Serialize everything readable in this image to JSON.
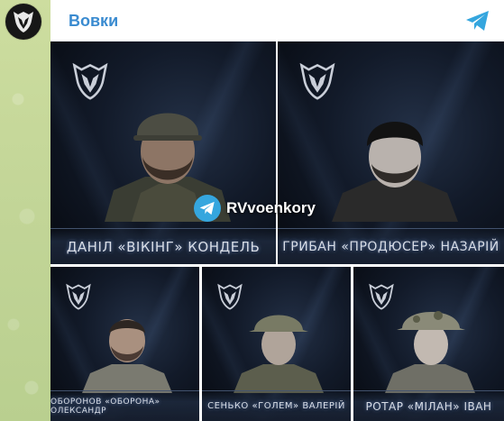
{
  "channel": {
    "name": "Вовки",
    "avatar_icon": "wolf-emblem-icon",
    "share_icon": "telegram-icon"
  },
  "watermark": {
    "text": "RVvoenkory",
    "icon": "telegram-icon"
  },
  "photos": [
    {
      "name_label": "ДАНІЛ «ВІКІНГ» КОНДЕЛЬ",
      "headgear": "helmet"
    },
    {
      "name_label": "ГРИБАН «ПРОДЮСЕР» НАЗАРІЙ",
      "headgear": "beanie"
    },
    {
      "name_label": "ОБОРОНОВ «ОБОРОНА» ОЛЕКСАНДР",
      "headgear": "none"
    },
    {
      "name_label": "СЕНЬКО «ГОЛЕМ» ВАЛЕРІЙ",
      "headgear": "boonie"
    },
    {
      "name_label": "РОТАР «МІЛАН» ІВАН",
      "headgear": "boonie-camo"
    }
  ],
  "colors": {
    "channel_name": "#3a8bd0",
    "telegram_blue": "#35a6de",
    "wallpaper": "#c6d79a"
  }
}
